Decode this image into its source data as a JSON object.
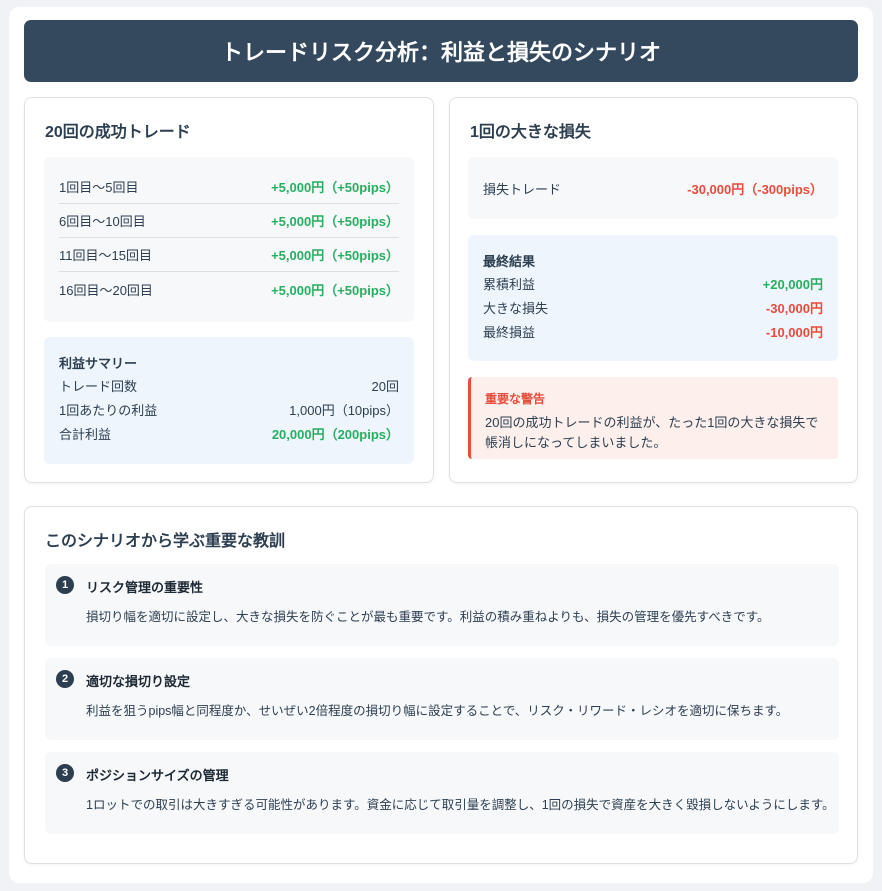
{
  "header": {
    "title": "トレードリスク分析：利益と損失のシナリオ"
  },
  "success": {
    "title": "20回の成功トレード",
    "rows": [
      {
        "label": "1回目～5回目",
        "value": "+5,000円（+50pips）"
      },
      {
        "label": "6回目～10回目",
        "value": "+5,000円（+50pips）"
      },
      {
        "label": "11回目～15回目",
        "value": "+5,000円（+50pips）"
      },
      {
        "label": "16回目～20回目",
        "value": "+5,000円（+50pips）"
      }
    ],
    "summary": {
      "title": "利益サマリー",
      "rows": [
        {
          "label": "トレード回数",
          "value": "20回"
        },
        {
          "label": "1回あたりの利益",
          "value": "1,000円（10pips）"
        },
        {
          "label": "合計利益",
          "value": "20,000円（200pips）"
        }
      ]
    }
  },
  "loss": {
    "title": "1回の大きな損失",
    "trade": {
      "label": "損失トレード",
      "value": "-30,000円（-300pips）"
    },
    "result": {
      "title": "最終結果",
      "rows": [
        {
          "label": "累積利益",
          "value": "+20,000円"
        },
        {
          "label": "大きな損失",
          "value": "-30,000円"
        },
        {
          "label": "最終損益",
          "value": "-10,000円"
        }
      ]
    },
    "warning": {
      "title": "重要な警告",
      "text": "20回の成功トレードの利益が、たった1回の大きな損失で帳消しになってしまいました。"
    }
  },
  "lessons": {
    "title": "このシナリオから学ぶ重要な教訓",
    "items": [
      {
        "num": "1",
        "title": "リスク管理の重要性",
        "text": "損切り幅を適切に設定し、大きな損失を防ぐことが最も重要です。利益の積み重ねよりも、損失の管理を優先すべきです。"
      },
      {
        "num": "2",
        "title": "適切な損切り設定",
        "text": "利益を狙うpips幅と同程度か、せいぜい2倍程度の損切り幅に設定することで、リスク・リワード・レシオを適切に保ちます。"
      },
      {
        "num": "3",
        "title": "ポジションサイズの管理",
        "text": "1ロットでの取引は大きすぎる可能性があります。資金に応じて取引量を調整し、1回の損失で資産を大きく毀損しないようにします。"
      }
    ]
  },
  "colors": {
    "header": "#34495e",
    "profit": "#27ae60",
    "loss": "#e74c3c"
  }
}
